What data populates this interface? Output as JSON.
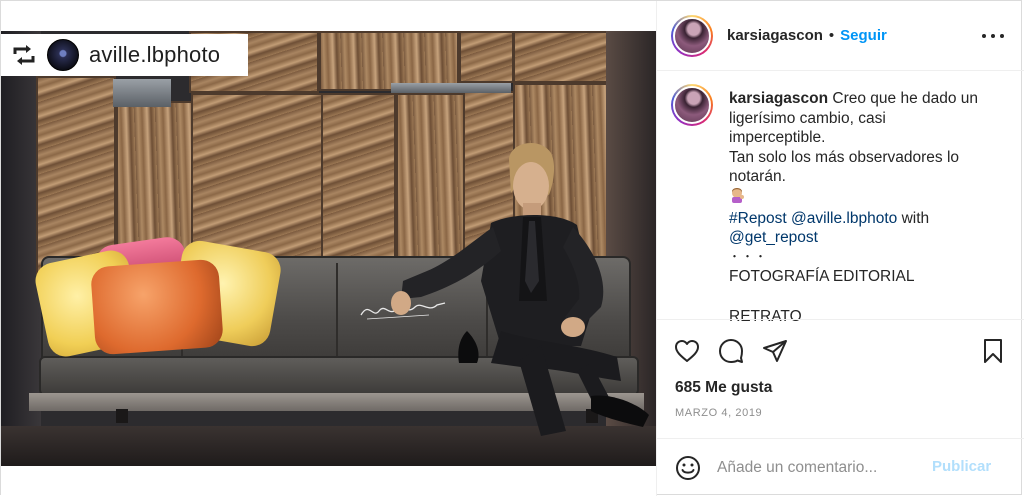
{
  "photo": {
    "repost_badge": {
      "icon": "repost-icon",
      "username": "aville.lbphoto"
    },
    "watermark_signature": "Lightwalker"
  },
  "header": {
    "username": "karsiagascon",
    "separator": "•",
    "follow_label": "Seguir",
    "more_icon": "more-options-icon"
  },
  "caption": {
    "username": "karsiagascon",
    "lines": [
      "Creo que he dado un",
      "ligerísimo cambio, casi",
      "imperceptible.",
      "Tan solo los más observadores lo",
      "notarán."
    ],
    "emoji": "woman-tipping-hand-emoji",
    "hashtag": "#Repost",
    "mention1": "@aville.lbphoto",
    "with": "with",
    "mention2": "@get_repost",
    "dots": "・・・",
    "line_extra": "FOTOGRAFÍA EDITORIAL",
    "line_cut": "RETRATO"
  },
  "actions": {
    "like_icon": "heart-icon",
    "comment_icon": "comment-icon",
    "share_icon": "share-icon",
    "save_icon": "bookmark-icon"
  },
  "likes_text": "685 Me gusta",
  "date_text": "MARZO 4, 2019",
  "comment": {
    "emoji_icon": "smiley-icon",
    "placeholder": "Añade un comentario...",
    "publish_label": "Publicar"
  },
  "colors": {
    "link": "#00376b",
    "follow": "#0095f6",
    "publish_disabled": "#b2dffc",
    "muted": "#8e8e8e"
  }
}
